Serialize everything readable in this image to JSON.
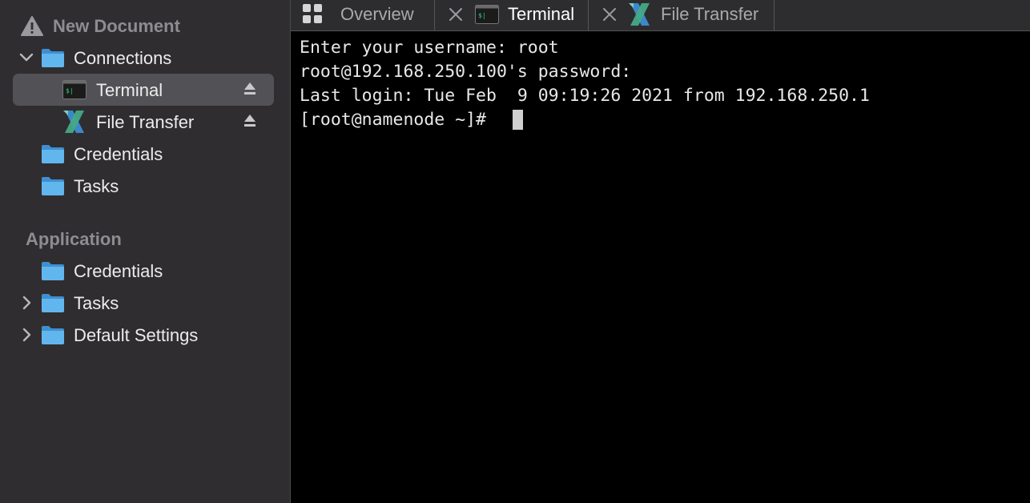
{
  "sidebar": {
    "document_title": "New Document",
    "connections": {
      "label": "Connections",
      "items": [
        {
          "label": "Terminal"
        },
        {
          "label": "File Transfer"
        }
      ]
    },
    "credentials_label": "Credentials",
    "tasks_label": "Tasks",
    "application": {
      "header": "Application",
      "items": [
        {
          "label": "Credentials"
        },
        {
          "label": "Tasks"
        },
        {
          "label": "Default Settings"
        }
      ]
    }
  },
  "tabs": [
    {
      "label": "Overview",
      "icon": "grid-icon"
    },
    {
      "label": "Terminal",
      "icon": "terminal-icon",
      "active": true
    },
    {
      "label": "File Transfer",
      "icon": "file-transfer-icon"
    }
  ],
  "terminal": {
    "lines": [
      "Enter your username: root",
      "root@192.168.250.100's password:",
      "Last login: Tue Feb  9 09:19:26 2021 from 192.168.250.1",
      "[root@namenode ~]# "
    ]
  },
  "colors": {
    "sidebar_bg": "#2f2d30",
    "selection_bg": "#525155",
    "folder_blue": "#5fb4ea",
    "terminal_bg": "#000000"
  }
}
